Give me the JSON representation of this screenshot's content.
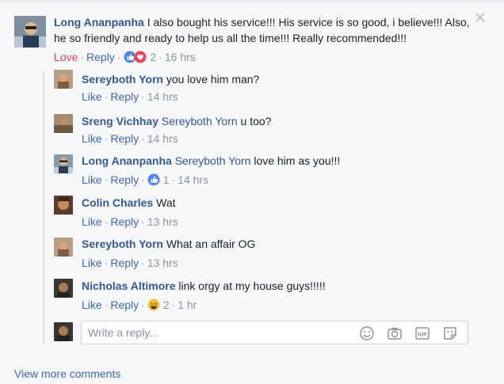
{
  "main_comment": {
    "author": "Long Ananpanha",
    "text": " I also bought his service!!! His service is so good, i believe!!! Also, he so friendly and ready to help us all the time!!! Really recommended!!!",
    "reaction_label": "Love",
    "reply_label": "Reply",
    "reaction_count": "2",
    "time": "16 hrs"
  },
  "replies": [
    {
      "author": "Sereyboth Yorn",
      "mention": "",
      "text": " you love him man?",
      "like": "Like",
      "reply": "Reply",
      "reaction_count": "",
      "time": "14 hrs"
    },
    {
      "author": "Sreng Vichhay",
      "mention": " Sereyboth Yorn",
      "text": " u too?",
      "like": "Like",
      "reply": "Reply",
      "reaction_count": "",
      "time": "14 hrs"
    },
    {
      "author": "Long Ananpanha",
      "mention": " Sereyboth Yorn",
      "text": " love him as you!!!",
      "like": "Like",
      "reply": "Reply",
      "reaction_count": "1",
      "time": "14 hrs"
    },
    {
      "author": "Colin Charles",
      "mention": "",
      "text": " Wat",
      "like": "Like",
      "reply": "Reply",
      "reaction_count": "",
      "time": "13 hrs"
    },
    {
      "author": "Sereyboth Yorn",
      "mention": "",
      "text": " What an affair OG",
      "like": "Like",
      "reply": "Reply",
      "reaction_count": "",
      "time": "13 hrs"
    },
    {
      "author": "Nicholas Altimore",
      "mention": "",
      "text": " link orgy at my house guys!!!!!",
      "like": "Like",
      "reply": "Reply",
      "reaction_count": "2",
      "time": "1 hr"
    }
  ],
  "reply_box": {
    "placeholder": "Write a reply..."
  },
  "footer": {
    "view_more": "View more comments"
  },
  "colors": {
    "link": "#4267b2",
    "name": "#365899",
    "muted": "#90949c",
    "love": "#f33e58"
  },
  "icons": [
    "close-icon",
    "like-reaction-icon",
    "love-reaction-icon",
    "haha-reaction-icon",
    "emoji-icon",
    "camera-icon",
    "gif-icon",
    "sticker-icon"
  ]
}
